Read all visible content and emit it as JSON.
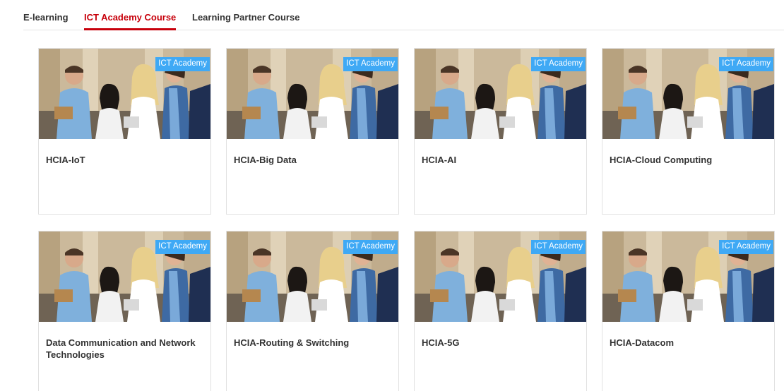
{
  "tabs": [
    {
      "label": "E-learning",
      "active": false
    },
    {
      "label": "ICT Academy Course",
      "active": true
    },
    {
      "label": "Learning Partner Course",
      "active": false
    }
  ],
  "accent_color": "#c7000b",
  "badge_color": "#3fa9f5",
  "courses": [
    {
      "title": "HCIA-IoT",
      "badge": "ICT Academy",
      "image": "students-photo"
    },
    {
      "title": "HCIA-Big Data",
      "badge": "ICT Academy",
      "image": "students-photo"
    },
    {
      "title": "HCIA-AI",
      "badge": "ICT Academy",
      "image": "students-photo"
    },
    {
      "title": "HCIA-Cloud Computing",
      "badge": "ICT Academy",
      "image": "students-photo"
    },
    {
      "title": "Data Communication and Network Technologies",
      "badge": "ICT Academy",
      "image": "students-photo"
    },
    {
      "title": "HCIA-Routing & Switching",
      "badge": "ICT Academy",
      "image": "students-photo"
    },
    {
      "title": "HCIA-5G",
      "badge": "ICT Academy",
      "image": "students-photo"
    },
    {
      "title": "HCIA-Datacom",
      "badge": "ICT Academy",
      "image": "students-photo"
    }
  ]
}
